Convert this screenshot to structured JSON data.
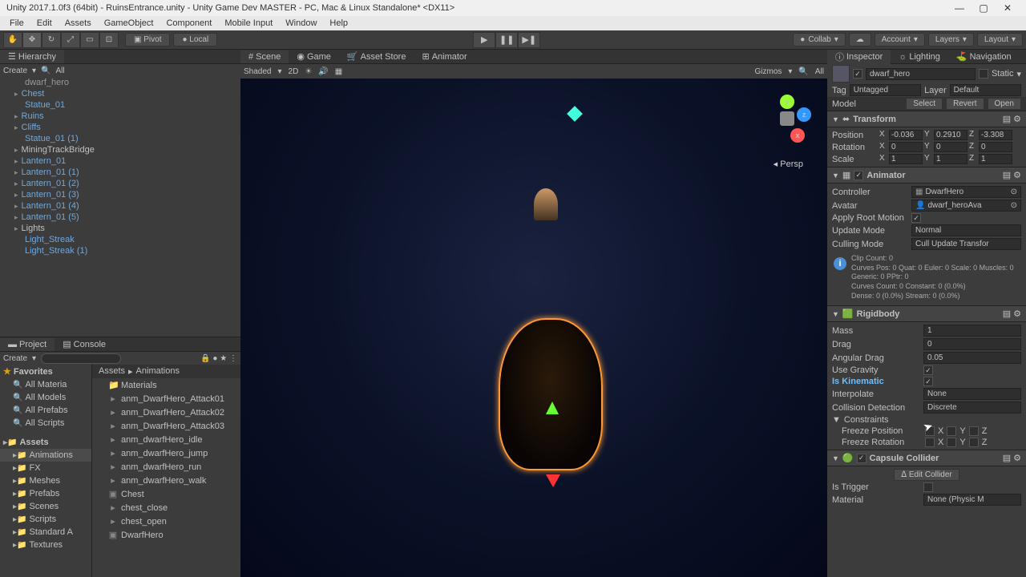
{
  "titlebar": "Unity 2017.1.0f3 (64bit) - RuinsEntrance.unity - Unity Game Dev MASTER - PC, Mac & Linux Standalone* <DX11>",
  "menu": [
    "File",
    "Edit",
    "Assets",
    "GameObject",
    "Component",
    "Mobile Input",
    "Window",
    "Help"
  ],
  "toolbar": {
    "pivot": "Pivot",
    "local": "Local",
    "collab": "Collab",
    "account": "Account",
    "layers": "Layers",
    "layout": "Layout"
  },
  "hierarchy": {
    "tab": "Hierarchy",
    "create": "Create",
    "qall": "All",
    "items": [
      {
        "label": "dwarf_hero",
        "color": "gray"
      },
      {
        "label": "Chest",
        "color": "blue",
        "arrow": true
      },
      {
        "label": "Statue_01",
        "color": "blue"
      },
      {
        "label": "Ruins",
        "color": "blue",
        "arrow": true
      },
      {
        "label": "Cliffs",
        "color": "blue",
        "arrow": true
      },
      {
        "label": "Statue_01 (1)",
        "color": "blue"
      },
      {
        "label": "MiningTrackBridge",
        "color": "white",
        "arrow": true
      },
      {
        "label": "Lantern_01",
        "color": "blue",
        "arrow": true
      },
      {
        "label": "Lantern_01 (1)",
        "color": "blue",
        "arrow": true
      },
      {
        "label": "Lantern_01 (2)",
        "color": "blue",
        "arrow": true
      },
      {
        "label": "Lantern_01 (3)",
        "color": "blue",
        "arrow": true
      },
      {
        "label": "Lantern_01 (4)",
        "color": "blue",
        "arrow": true
      },
      {
        "label": "Lantern_01 (5)",
        "color": "blue",
        "arrow": true
      },
      {
        "label": "Lights",
        "color": "white",
        "arrow": true
      },
      {
        "label": "Light_Streak",
        "color": "blue"
      },
      {
        "label": "Light_Streak (1)",
        "color": "blue"
      }
    ]
  },
  "project": {
    "tab_project": "Project",
    "tab_console": "Console",
    "create": "Create",
    "favorites": "Favorites",
    "fav_items": [
      "All Materia",
      "All Models",
      "All Prefabs",
      "All Scripts"
    ],
    "assets_header": "Assets",
    "folders": [
      "Animations",
      "FX",
      "Meshes",
      "Prefabs",
      "Scenes",
      "Scripts",
      "Standard A",
      "Textures"
    ],
    "crumb_assets": "Assets",
    "crumb_anim": "Animations",
    "files": [
      {
        "name": "Materials",
        "icon": "folder"
      },
      {
        "name": "anm_DwarfHero_Attack01",
        "icon": "anim"
      },
      {
        "name": "anm_DwarfHero_Attack02",
        "icon": "anim"
      },
      {
        "name": "anm_DwarfHero_Attack03",
        "icon": "anim"
      },
      {
        "name": "anm_dwarfHero_idle",
        "icon": "anim"
      },
      {
        "name": "anm_dwarfHero_jump",
        "icon": "anim"
      },
      {
        "name": "anm_dwarfHero_run",
        "icon": "anim"
      },
      {
        "name": "anm_dwarfHero_walk",
        "icon": "anim"
      },
      {
        "name": "Chest",
        "icon": "model"
      },
      {
        "name": "chest_close",
        "icon": "anim"
      },
      {
        "name": "chest_open",
        "icon": "anim"
      },
      {
        "name": "DwarfHero",
        "icon": "model"
      }
    ]
  },
  "scene": {
    "tab_scene": "Scene",
    "tab_game": "Game",
    "tab_store": "Asset Store",
    "tab_animator": "Animator",
    "shaded": "Shaded",
    "mode2d": "2D",
    "gizmos": "Gizmos",
    "all": "All",
    "persp": "Persp",
    "axis_x": "x",
    "axis_y": "y",
    "axis_z": "z"
  },
  "inspector": {
    "tab_inspector": "Inspector",
    "tab_lighting": "Lighting",
    "tab_navigation": "Navigation",
    "name": "dwarf_hero",
    "static": "Static",
    "tag": "Tag",
    "tag_val": "Untagged",
    "layer": "Layer",
    "layer_val": "Default",
    "model": "Model",
    "select": "Select",
    "revert": "Revert",
    "open": "Open",
    "transform": {
      "title": "Transform",
      "position": "Position",
      "rotation": "Rotation",
      "scale": "Scale",
      "px": "-0.036",
      "py": "0.2910",
      "pz": "-3.308",
      "rx": "0",
      "ry": "0",
      "rz": "0",
      "sx": "1",
      "sy": "1",
      "sz": "1"
    },
    "animator": {
      "title": "Animator",
      "controller": "Controller",
      "controller_val": "DwarfHero",
      "avatar": "Avatar",
      "avatar_val": "dwarf_heroAva",
      "apply_root": "Apply Root Motion",
      "update_mode": "Update Mode",
      "update_val": "Normal",
      "culling_mode": "Culling Mode",
      "culling_val": "Cull Update Transfor",
      "info": "Clip Count: 0\nCurves Pos: 0 Quat: 0 Euler: 0 Scale: 0 Muscles: 0 Generic: 0 PPtr: 0\nCurves Count: 0 Constant: 0 (0.0%)\nDense: 0 (0.0%) Stream: 0 (0.0%)"
    },
    "rigidbody": {
      "title": "Rigidbody",
      "mass": "Mass",
      "mass_val": "1",
      "drag": "Drag",
      "drag_val": "0",
      "angular_drag": "Angular Drag",
      "angular_drag_val": "0.05",
      "use_gravity": "Use Gravity",
      "is_kinematic": "Is Kinematic",
      "interpolate": "Interpolate",
      "interpolate_val": "None",
      "collision": "Collision Detection",
      "collision_val": "Discrete",
      "constraints": "Constraints",
      "freeze_pos": "Freeze Position",
      "freeze_rot": "Freeze Rotation"
    },
    "capsule": {
      "title": "Capsule Collider",
      "edit": "Edit Collider",
      "is_trigger": "Is Trigger",
      "material": "Material",
      "material_val": "None (Physic M"
    }
  }
}
